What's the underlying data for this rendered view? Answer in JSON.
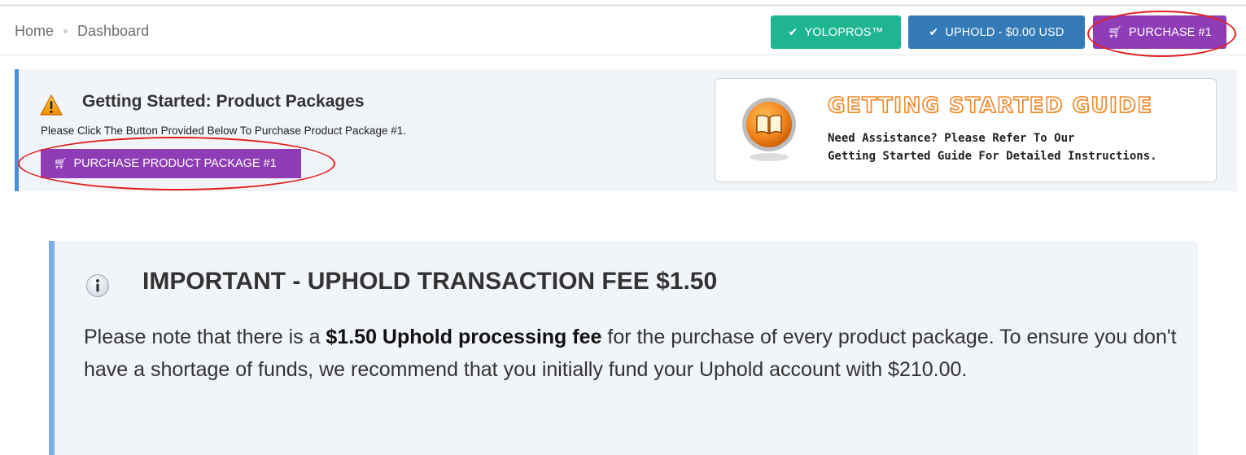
{
  "breadcrumb": {
    "home": "Home",
    "current": "Dashboard"
  },
  "top_buttons": {
    "yolopros": "YOLOPROS™",
    "uphold": "UPHOLD - $0.00 USD",
    "purchase": "PURCHASE #1"
  },
  "getting_started": {
    "title": "Getting Started: Product Packages",
    "description": "Please Click The Button Provided Below To Purchase Product Package #1.",
    "button_label": "PURCHASE PRODUCT PACKAGE #1"
  },
  "guide": {
    "title": "GETTING STARTED GUIDE",
    "line1": "Need Assistance? Please Refer To Our",
    "line2": "Getting Started Guide For Detailed Instructions."
  },
  "important": {
    "title": "IMPORTANT - UPHOLD TRANSACTION FEE $1.50",
    "body_before": "Please note that there is a ",
    "body_bold": "$1.50 Uphold processing fee",
    "body_after": " for the purchase of every product package. To ensure you don't have a shortage of funds, we recommend that you initially fund your Uphold account with $210.00."
  },
  "icons": {
    "check": "check-icon",
    "cart": "cart-icon",
    "warning": "warning-icon",
    "book": "book-icon",
    "info": "info-icon"
  },
  "colors": {
    "yolopros": "#1fb592",
    "uphold": "#337ab7",
    "purchase": "#8f3db6",
    "annotation": "#e2201f",
    "guide_title": "#f28a2a"
  }
}
